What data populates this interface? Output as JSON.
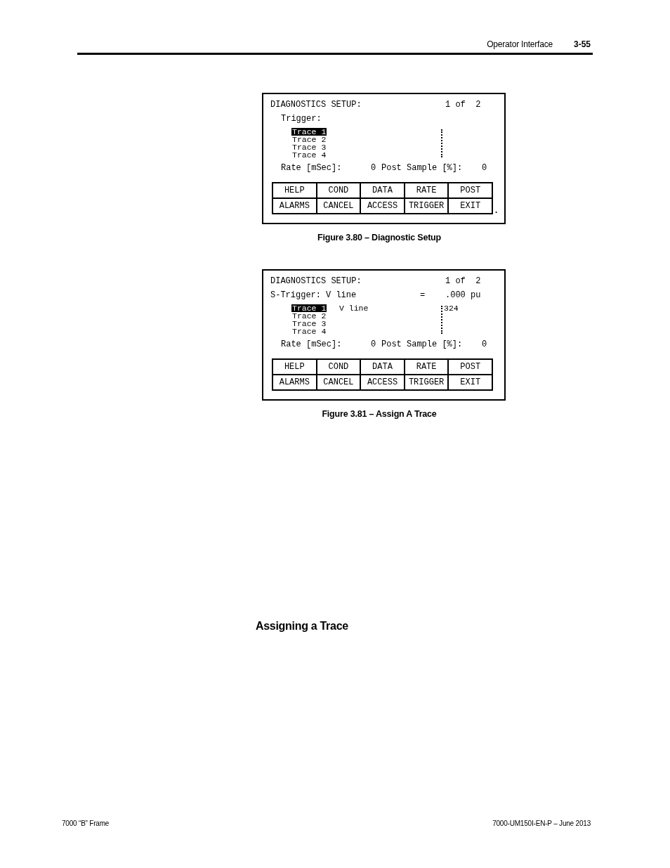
{
  "header": {
    "section": "Operator Interface",
    "page": "3-55"
  },
  "figures": [
    {
      "screen": {
        "title": "DIAGNOSTICS SETUP:",
        "page_indicator": "1 of  2",
        "trigger": {
          "kind": "prompt",
          "label": "Trigger:"
        },
        "traces": [
          {
            "label": "Trace 1",
            "selected": true
          },
          {
            "label": "Trace 2",
            "selected": false
          },
          {
            "label": "Trace 3",
            "selected": false
          },
          {
            "label": "Trace 4",
            "selected": false
          }
        ],
        "rate": {
          "label": "Rate [mSec]:",
          "value": "0"
        },
        "post_sample": {
          "label": "Post Sample [%]:",
          "value": "0"
        },
        "softkeys": [
          [
            "HELP",
            "COND",
            "DATA",
            "RATE",
            "POST"
          ],
          [
            "ALARMS",
            "CANCEL",
            "ACCESS",
            "TRIGGER",
            "EXIT"
          ]
        ],
        "trailing_mark": "."
      },
      "caption": "Figure 3.80 – Diagnostic Setup"
    },
    {
      "screen": {
        "title": "DIAGNOSTICS SETUP:",
        "page_indicator": "1 of  2",
        "trigger": {
          "kind": "assigned",
          "label": "S-Trigger:",
          "signal": "V line",
          "operator": "=",
          "value": ".000 pu"
        },
        "traces": [
          {
            "label": "Trace 1",
            "selected": true,
            "signal": "V line",
            "value": "324"
          },
          {
            "label": "Trace 2",
            "selected": false
          },
          {
            "label": "Trace 3",
            "selected": false
          },
          {
            "label": "Trace 4",
            "selected": false
          }
        ],
        "rate": {
          "label": "Rate [mSec]:",
          "value": "0"
        },
        "post_sample": {
          "label": "Post Sample [%]:",
          "value": "0"
        },
        "softkeys": [
          [
            "HELP",
            "COND",
            "DATA",
            "RATE",
            "POST"
          ],
          [
            "ALARMS",
            "CANCEL",
            "ACCESS",
            "TRIGGER",
            "EXIT"
          ]
        ]
      },
      "caption": "Figure 3.81 – Assign A Trace"
    }
  ],
  "section_heading": "Assigning a Trace",
  "footer": {
    "left": "7000 “B” Frame",
    "right": "7000-UM150I-EN-P – June 2013"
  }
}
